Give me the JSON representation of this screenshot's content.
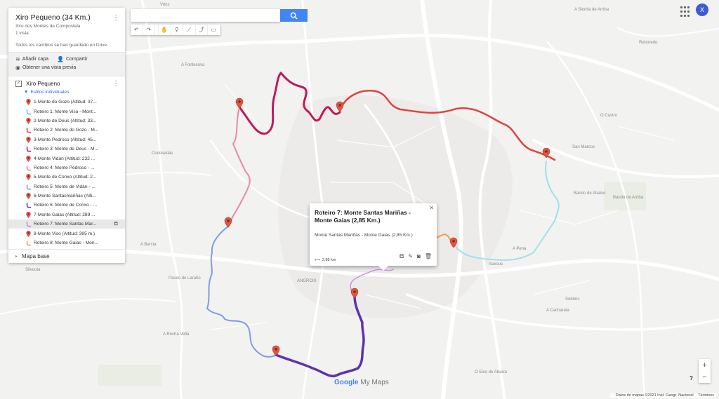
{
  "map_title": "Xiro Pequeno (34 Km.)",
  "map_subtitle": "Xiro dos Montes de Compostela",
  "views": "1 vista",
  "saved_text": "Todos los cambios se han guardado en Drive.",
  "actions": {
    "add_layer": "Añadir capa",
    "share": "Compartir",
    "preview": "Obtener una vista previa"
  },
  "layer": {
    "name": "Xiro Pequeno",
    "style": "Estilos individuales"
  },
  "items": [
    {
      "label": "1-Monte do Gozo (Altitud: 37...",
      "kind": "marker",
      "color": "#e2553f"
    },
    {
      "label": "Roteiro 1: Monte Viso - Mont...",
      "kind": "route",
      "color": "#7db7ea"
    },
    {
      "label": "2-Monte de Deus (Altitud: 33...",
      "kind": "marker",
      "color": "#e2553f"
    },
    {
      "label": "Roteiro 2: Monte do Gozo - M...",
      "kind": "route",
      "color": "#e0433b"
    },
    {
      "label": "3-Monte Pedroso (Altitud: 45...",
      "kind": "marker",
      "color": "#e2553f"
    },
    {
      "label": "Roteiro 3: Monte de Deus - M...",
      "kind": "route",
      "color": "#c2185b"
    },
    {
      "label": "4-Monte Vidán (Altitud: 232 ...",
      "kind": "marker",
      "color": "#e2553f"
    },
    {
      "label": "Roteiro 4: Monte Pedroso - ...",
      "kind": "route",
      "color": "#e88aa5"
    },
    {
      "label": "5-Monte de Conxo (Altitud: 2...",
      "kind": "marker",
      "color": "#e2553f"
    },
    {
      "label": "Roteiro 5: Monte de Vidán - ...",
      "kind": "route",
      "color": "#7c9fe0"
    },
    {
      "label": "6-Monte Santasmariñas (Alti...",
      "kind": "marker",
      "color": "#e2553f"
    },
    {
      "label": "Roteiro 6: Monte de Conxo - ...",
      "kind": "route",
      "color": "#6a3fb5"
    },
    {
      "label": "7-Monte Gaias (Altitud: 289 ...",
      "kind": "marker",
      "color": "#e2553f"
    },
    {
      "label": "Roteiro 7: Monte Santas Mar...",
      "kind": "route",
      "color": "#c58be0",
      "selected": true
    },
    {
      "label": "8-Monte Viso (Altitud: 395 m.)",
      "kind": "marker",
      "color": "#e2553f"
    },
    {
      "label": "Roteiro 8: Monte Gaias - Mon...",
      "kind": "route",
      "color": "#f0a050"
    }
  ],
  "base_map": "Mapa base",
  "search_placeholder": "",
  "avatar_initial": "X",
  "popup": {
    "title": "Roteiro 7: Monte Santas Mariñas - Monte Gaias (2,85 Km.)",
    "description": "Monte Santas Mariñas - Monte Gaias (2,85 Km.)",
    "length": "2,85 km"
  },
  "footer": {
    "attribution": "Datos de mapas ©2021 Inst. Geogr. Nacional",
    "terms": "Términos"
  },
  "help": "?",
  "logo": {
    "google": "Google",
    "mymaps": "My Maps"
  },
  "place_labels": {
    "vrins": "Vrins",
    "a_fontecova": "A Fontecova",
    "a_sionlla": "A Sionlla de Arriba",
    "reboredo": "Reboredo",
    "o_castro": "O Castro",
    "sar_marcos": "San Marcos",
    "bando_abaixo": "Bando de Abaixo",
    "bando_arriba": "Bando de Arriba",
    "codesedas": "Codesedas",
    "a_barcia": "A Barcia",
    "silvouta": "Silvouta",
    "angrois": "ANGROIS",
    "paseo_larano": "Paseo de Laraño",
    "a_rocha_vella": "A Rocha Vella",
    "a_pena": "A Pena",
    "saxous": "Saxous",
    "a_cacharela": "A Cacharela",
    "sobrins": "Sobrins",
    "o_eixo": "O Eixo de Abaixo"
  }
}
